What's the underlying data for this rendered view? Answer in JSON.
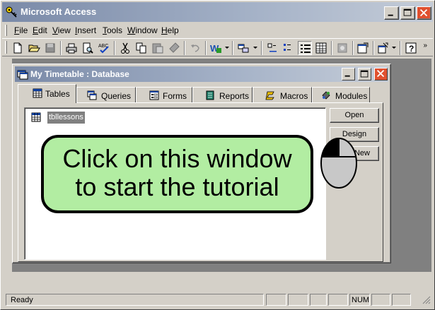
{
  "app": {
    "title": "Microsoft Access",
    "icon": "key-icon"
  },
  "menu": {
    "items": [
      {
        "label": "File",
        "accel": "F",
        "rest": "ile"
      },
      {
        "label": "Edit",
        "accel": "E",
        "rest": "dit"
      },
      {
        "label": "View",
        "accel": "V",
        "rest": "iew"
      },
      {
        "label": "Insert",
        "accel": "I",
        "rest": "nsert"
      },
      {
        "label": "Tools",
        "accel": "T",
        "rest": "ools"
      },
      {
        "label": "Window",
        "accel": "W",
        "rest": "indow"
      },
      {
        "label": "Help",
        "accel": "H",
        "rest": "elp"
      }
    ]
  },
  "toolbar": {
    "overflow": "»",
    "tools": [
      "new-icon",
      "open-icon",
      "save-icon",
      "print-icon",
      "print-preview-icon",
      "spelling-icon",
      "cut-icon",
      "copy-icon",
      "paste-icon",
      "format-painter-icon",
      "undo-icon",
      "office-links-icon",
      "analyze-icon",
      "large-icons-icon",
      "small-icons-icon",
      "list-icon",
      "details-icon",
      "code-icon",
      "properties-icon",
      "relationships-icon",
      "new-object-icon",
      "help-icon"
    ]
  },
  "database_window": {
    "title": "My Timetable : Database",
    "tabs": [
      {
        "label": "Tables",
        "icon": "tables-icon",
        "active": true
      },
      {
        "label": "Queries",
        "icon": "queries-icon",
        "active": false
      },
      {
        "label": "Forms",
        "icon": "forms-icon",
        "active": false
      },
      {
        "label": "Reports",
        "icon": "reports-icon",
        "active": false
      },
      {
        "label": "Macros",
        "icon": "macros-icon",
        "active": false
      },
      {
        "label": "Modules",
        "icon": "modules-icon",
        "active": false
      }
    ],
    "objects": [
      {
        "label": "tbllessons",
        "icon": "table-icon",
        "selected": true
      }
    ],
    "buttons": {
      "open": "Open",
      "design": "Design",
      "new": "New"
    }
  },
  "status": {
    "text": "Ready",
    "num": "NUM"
  },
  "tutorial": {
    "line1": "Click on this window",
    "line2": "to start the tutorial",
    "icon": "mouse-left-click-icon"
  },
  "colors": {
    "callout_fill": "#b2eda2",
    "titlebar_start": "#7a8aa8",
    "close_button": "#e0502f"
  }
}
